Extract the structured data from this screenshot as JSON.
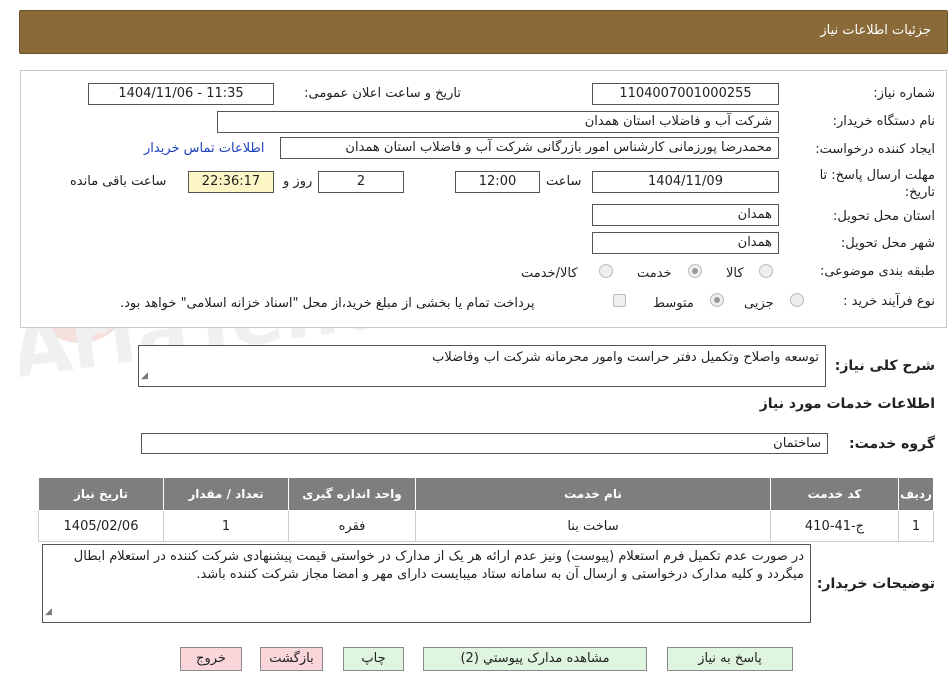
{
  "header": {
    "title": "جزئیات اطلاعات نیاز"
  },
  "form": {
    "need_number_label": "شماره نیاز:",
    "need_number": "1104007001000255",
    "announce_label": "تاریخ و ساعت اعلان عمومی:",
    "announce_value": "1404/11/06 - 11:35",
    "buyer_org_label": "نام دستگاه خریدار:",
    "buyer_org": "شرکت آب و فاضلاب استان همدان",
    "requester_label": "ایجاد کننده درخواست:",
    "requester": "محمدرضا پورزمانی کارشناس امور بازرگانی شرکت آب و فاضلاب استان همدان",
    "contact_link": "اطلاعات تماس خریدار",
    "deadline_label_1": "مهلت ارسال پاسخ: تا",
    "deadline_label_2": "تاریخ:",
    "deadline_date": "1404/11/09",
    "time_label": "ساعت",
    "deadline_time": "12:00",
    "days": "2",
    "days_label": "روز و",
    "remaining": "22:36:17",
    "remaining_label": "ساعت باقی مانده",
    "province_label": "استان محل تحویل:",
    "province": "همدان",
    "city_label": "شهر محل تحویل:",
    "city": "همدان",
    "category_label": "طبقه بندی موضوعی:",
    "category_options": [
      "کالا",
      "خدمت",
      "کالا/خدمت"
    ],
    "category_selected": "خدمت",
    "process_label": "نوع فرآیند خرید :",
    "process_options": [
      "جزیی",
      "متوسط"
    ],
    "process_selected": "متوسط",
    "treasury_note": "پرداخت تمام یا بخشی از مبلغ خرید،از محل \"اسناد خزانه اسلامی\" خواهد بود."
  },
  "description": {
    "label": "شرح کلی نیاز:",
    "text": "توسعه واصلاح وتکمیل دفتر حراست وامور محرمانه شرکت اب وفاضلاب"
  },
  "services": {
    "section_title": "اطلاعات خدمات مورد نیاز",
    "group_label": "گروه خدمت:",
    "group_value": "ساختمان",
    "columns": [
      "ردیف",
      "کد خدمت",
      "نام خدمت",
      "واحد اندازه گیری",
      "تعداد / مقدار",
      "تاریخ نیاز"
    ],
    "rows": [
      [
        "1",
        "ج-41-410",
        "ساخت بنا",
        "فقره",
        "1",
        "1405/02/06"
      ]
    ]
  },
  "buyer_notes": {
    "label": "توضیحات خریدار:",
    "text": "در صورت عدم تکمیل فرم استعلام (پیوست) ونیز عدم ارائه هر یک از مدارک در خواستی قیمت پیشنهادی شرکت کننده در استعلام ابطال میگردد و کلیه مدارک درخواستی و ارسال آن به سامانه ستاد میبایست دارای مهر و امضا مجاز شرکت کننده باشد."
  },
  "buttons": {
    "reply": "پاسخ به نیاز",
    "attachments": "مشاهده مدارک پیوستي (2)",
    "print": "چاپ",
    "back": "بازگشت",
    "exit": "خروج"
  },
  "colors": {
    "header": "#8b6a3a",
    "button_green": "#dff5df",
    "button_red": "#f9d6d9",
    "table_header": "#7e7e7e"
  }
}
